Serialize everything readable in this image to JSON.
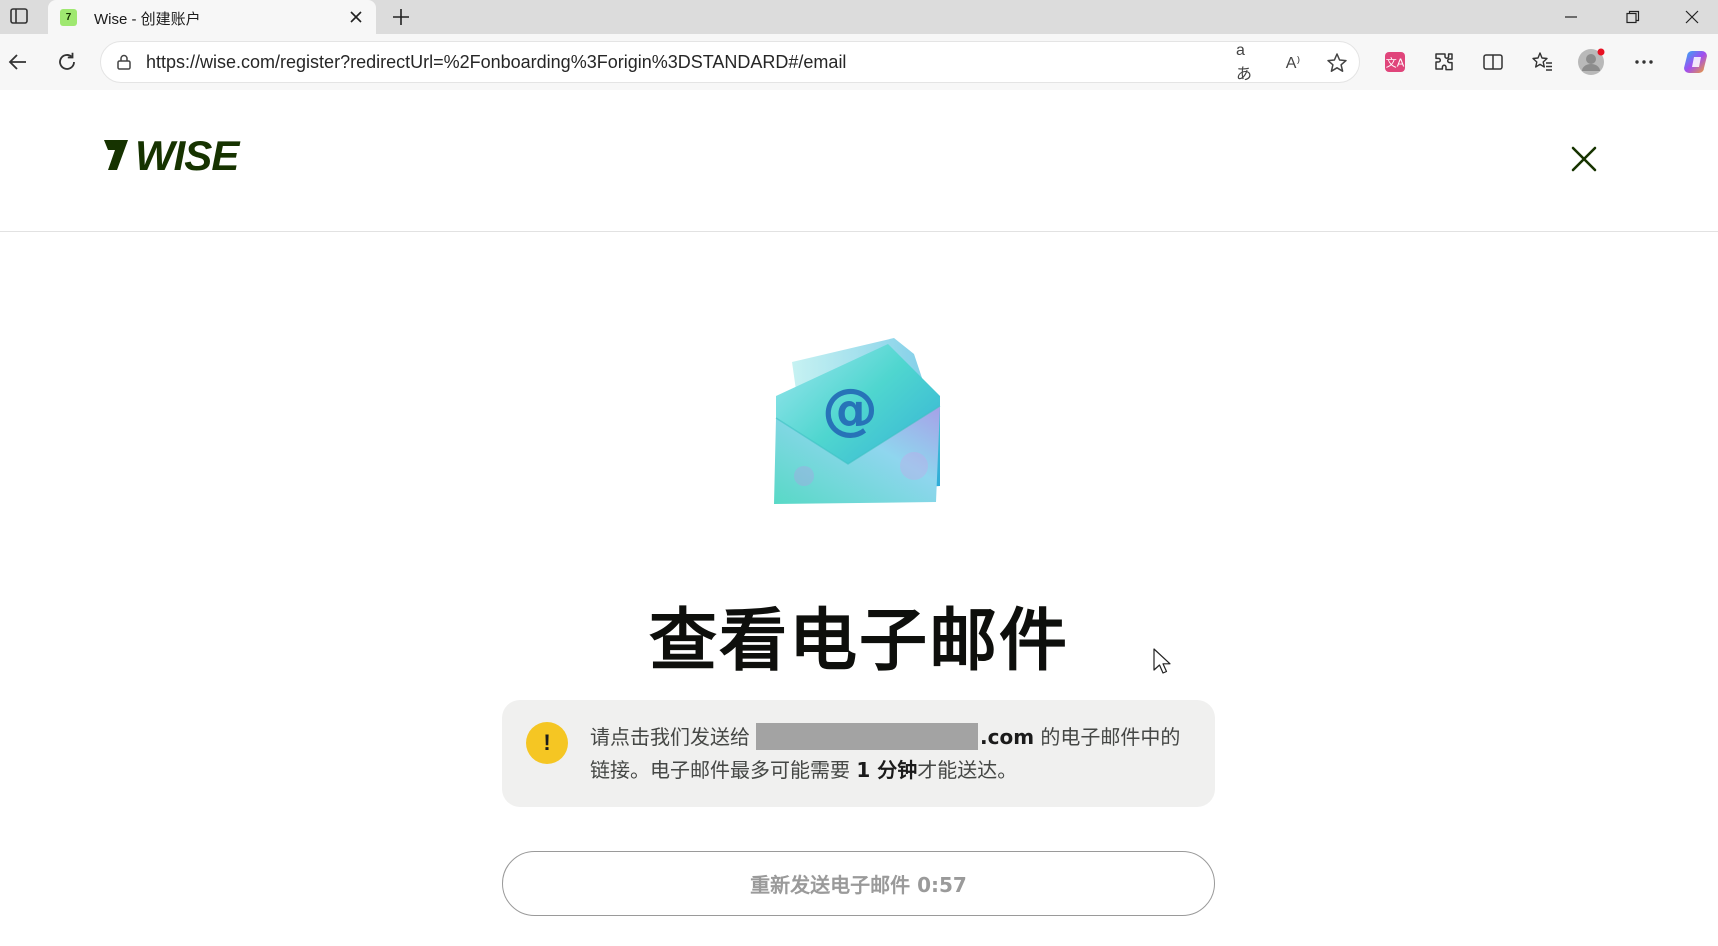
{
  "browser": {
    "tab_title": "Wise - 创建账户",
    "favicon_text": "7",
    "url": "https://wise.com/register?redirectUrl=%2Fonboarding%3Forigin%3DSTANDARD#/email",
    "translate_icon_text": "aあ",
    "read_aloud_icon_text": "A⁾",
    "window_controls": [
      "minimize",
      "restore",
      "close"
    ]
  },
  "header": {
    "logo_text": "WISE",
    "brand_color": "#163300"
  },
  "main": {
    "illustration": "open-envelope-at-sign",
    "headline": "查看电子邮件",
    "alert": {
      "text_before": "请点击我们发送给",
      "email_suffix": ".com",
      "text_after_email": "的电子邮件中的链接。电子邮件最多可能需要",
      "emphasis": "1 分钟",
      "text_end": "才能送达。",
      "icon": "!"
    },
    "resend_button": "重新发送电子邮件 0:57"
  }
}
